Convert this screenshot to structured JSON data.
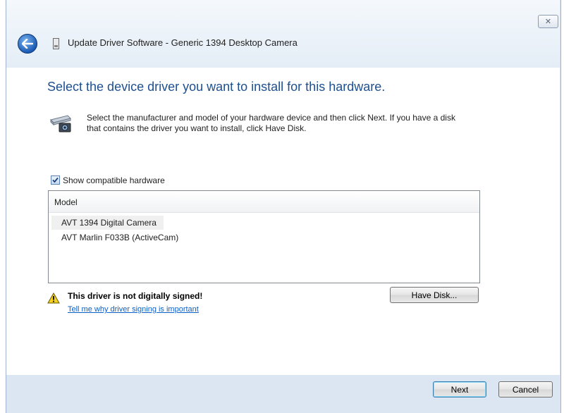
{
  "window": {
    "title": "Update Driver Software - Generic 1394 Desktop Camera",
    "close_glyph": "✕"
  },
  "main": {
    "heading": "Select the device driver you want to install for this hardware.",
    "instruction": "Select the manufacturer and model of your hardware device and then click Next. If you have a disk that contains the driver you want to install, click Have Disk.",
    "show_compatible": {
      "label": "Show compatible hardware",
      "checked": true
    },
    "list": {
      "column_header": "Model",
      "items": [
        {
          "label": "AVT 1394 Digital Camera",
          "selected": true
        },
        {
          "label": "AVT Marlin F033B (ActiveCam)",
          "selected": false
        }
      ]
    },
    "warning": {
      "text": "This driver is not digitally signed!",
      "link": "Tell me why driver signing is important"
    },
    "have_disk_label": "Have Disk..."
  },
  "footer": {
    "next_label": "Next",
    "cancel_label": "Cancel"
  },
  "icons": {
    "back": "back-arrow-icon",
    "device": "camera-device-icon",
    "warning": "warning-triangle-icon"
  }
}
